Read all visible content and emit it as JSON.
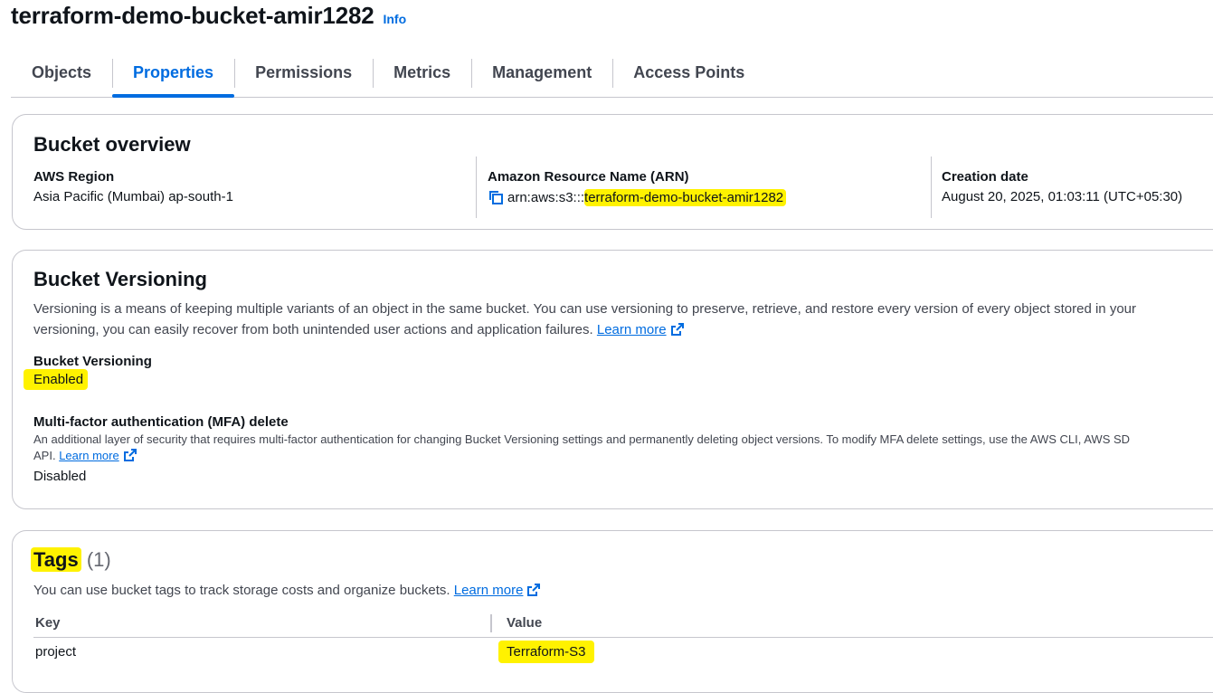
{
  "header": {
    "title": "terraform-demo-bucket-amir1282",
    "info": "Info"
  },
  "tabs": [
    {
      "label": "Objects"
    },
    {
      "label": "Properties",
      "active": true
    },
    {
      "label": "Permissions"
    },
    {
      "label": "Metrics"
    },
    {
      "label": "Management"
    },
    {
      "label": "Access Points"
    }
  ],
  "overview": {
    "title": "Bucket overview",
    "region_label": "AWS Region",
    "region_value": "Asia Pacific (Mumbai) ap-south-1",
    "arn_label": "Amazon Resource Name (ARN)",
    "arn_prefix": "arn:aws:s3:::",
    "arn_bucket": "terraform-demo-bucket-amir1282",
    "creation_label": "Creation date",
    "creation_value": "August 20, 2025, 01:03:11 (UTC+05:30)"
  },
  "versioning": {
    "title": "Bucket Versioning",
    "description_line1": "Versioning is a means of keeping multiple variants of an object in the same bucket. You can use versioning to preserve, retrieve, and restore every version of every object stored in your",
    "description_line2": "versioning, you can easily recover from both unintended user actions and application failures.",
    "learn_more": "Learn more",
    "status_label": "Bucket Versioning",
    "status_value": "Enabled",
    "mfa_label": "Multi-factor authentication (MFA) delete",
    "mfa_desc_line1": "An additional layer of security that requires multi-factor authentication for changing Bucket Versioning settings and permanently deleting object versions. To modify MFA delete settings, use the AWS CLI, AWS SD",
    "mfa_desc_line2": "API.",
    "mfa_learn_more": "Learn more",
    "mfa_value": "Disabled"
  },
  "tags": {
    "title": "Tags",
    "count": "(1)",
    "description": "You can use bucket tags to track storage costs and organize buckets.",
    "learn_more": "Learn more",
    "columns": {
      "key": "Key",
      "value": "Value"
    },
    "rows": [
      {
        "key": "project",
        "value": "Terraform-S3"
      }
    ]
  },
  "colors": {
    "link": "#006ce0",
    "highlight": "#fff200",
    "border": "#c6c6cd"
  },
  "icons": [
    "copy-icon",
    "external-link-icon"
  ]
}
